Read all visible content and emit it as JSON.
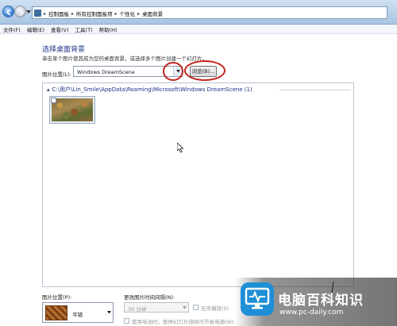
{
  "address_bar": {
    "crumbs": [
      "控制面板",
      "所有控制面板项",
      "个性化",
      "桌面背景"
    ]
  },
  "menu": {
    "items": [
      "文件(F)",
      "编辑(E)",
      "查看(V)",
      "工具(T)",
      "帮助(H)"
    ]
  },
  "main": {
    "heading": "选择桌面背景",
    "subtitle": "单击某个图片使其成为您的桌面背景，或选择多个图片创建一个幻灯片。",
    "picture_location_label": "图片位置(L):",
    "picture_location_value": "Windows DreamScene",
    "browse_label": "浏览(B)...",
    "group_path": "C:\\用户\\Lin_Smile\\AppData\\Roaming\\Microsoft\\Windows DreamScene (1)"
  },
  "bottom": {
    "position_label": "图片位置(P):",
    "position_value": "平铺",
    "interval_label": "更改图片时间间隔(N):",
    "interval_value": "30 分钟",
    "shuffle_label": "无序播放(S)",
    "battery_label": "使用电池时，暂停幻灯片放映可节省电源(W)"
  },
  "watermark": {
    "title": "电脑百科知识",
    "url": "www.pc-daily.com"
  },
  "colors": {
    "heading_blue": "#1e3287",
    "annotation_red": "#c0251c",
    "watermark_logo": "#1f8fd6"
  }
}
